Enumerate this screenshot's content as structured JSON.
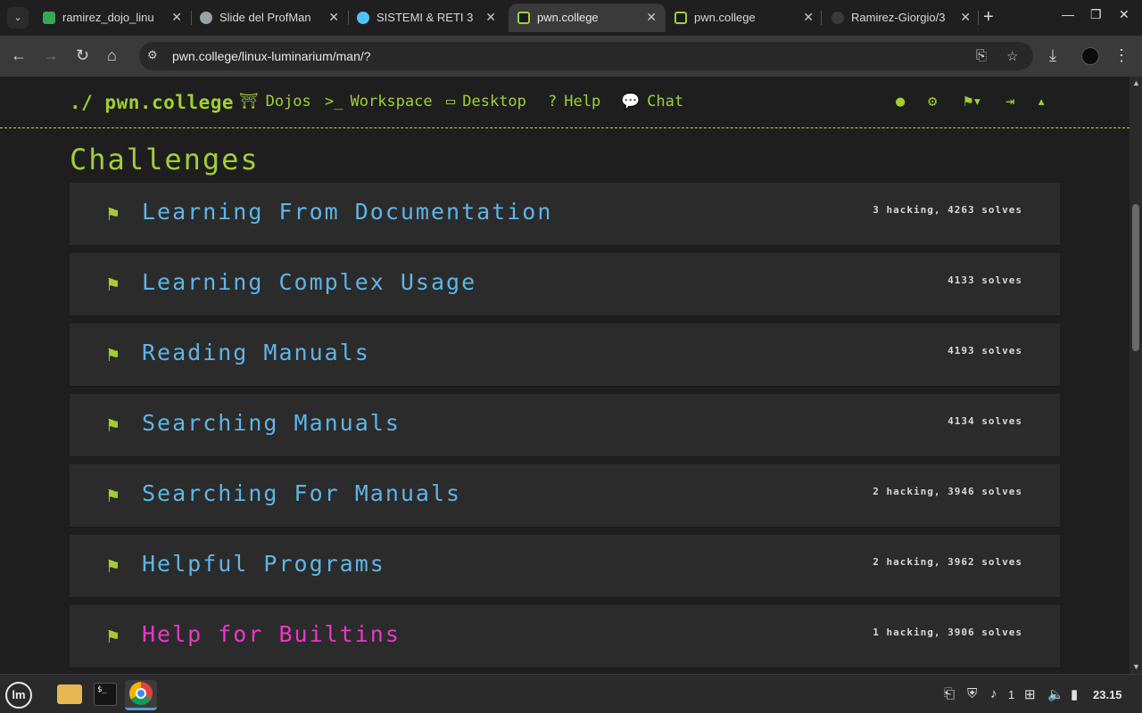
{
  "browser": {
    "tabs": [
      {
        "title": "ramirez_dojo_linu",
        "favicon_color": "#34a853"
      },
      {
        "title": "Slide del ProfMan",
        "favicon_color": "#9aa0a6"
      },
      {
        "title": "SISTEMI & RETI 3",
        "favicon_color": "#4fc3f7"
      },
      {
        "title": "pwn.college",
        "favicon_color": "#a2ce34"
      },
      {
        "title": "pwn.college",
        "favicon_color": "#a2ce34"
      },
      {
        "title": "Ramirez-Giorgio/3",
        "favicon_color": "#bdbdbd"
      }
    ],
    "active_tab_index": 3,
    "url": "pwn.college/linux-luminarium/man/?"
  },
  "site": {
    "brand": "./ pwn.college",
    "nav": [
      {
        "label": "Dojos",
        "icon": "dojo-icon"
      },
      {
        "label": "Workspace",
        "icon": "terminal-icon"
      },
      {
        "label": "Desktop",
        "icon": "monitor-icon"
      },
      {
        "label": "Help",
        "icon": "question-icon"
      },
      {
        "label": "Chat",
        "icon": "chat-icon"
      }
    ],
    "right_icons": [
      "user-circle-icon",
      "cogs-icon",
      "flag-dropdown-icon",
      "logout-icon",
      "caret-up-icon"
    ],
    "accent_color": "#a2ce34"
  },
  "main": {
    "heading": "Challenges",
    "challenges": [
      {
        "title": "Learning From Documentation",
        "stats": "3 hacking, 4263 solves",
        "status": "solved"
      },
      {
        "title": "Learning Complex Usage",
        "stats": "4133 solves",
        "status": "solved"
      },
      {
        "title": "Reading Manuals",
        "stats": "4193 solves",
        "status": "solved"
      },
      {
        "title": "Searching Manuals",
        "stats": "4134 solves",
        "status": "solved"
      },
      {
        "title": "Searching For Manuals",
        "stats": "2 hacking, 3946 solves",
        "status": "solved"
      },
      {
        "title": "Helpful Programs",
        "stats": "2 hacking, 3962 solves",
        "status": "solved"
      },
      {
        "title": "Help for Builtins",
        "stats": "1 hacking, 3906 solves",
        "status": "active"
      }
    ],
    "title_color": "#5fb5e6",
    "active_title_color": "#e838c8"
  },
  "taskbar": {
    "apps": [
      "files-icon",
      "terminal-icon",
      "chrome-icon"
    ],
    "notification_count": "1",
    "clock": "23.15"
  }
}
